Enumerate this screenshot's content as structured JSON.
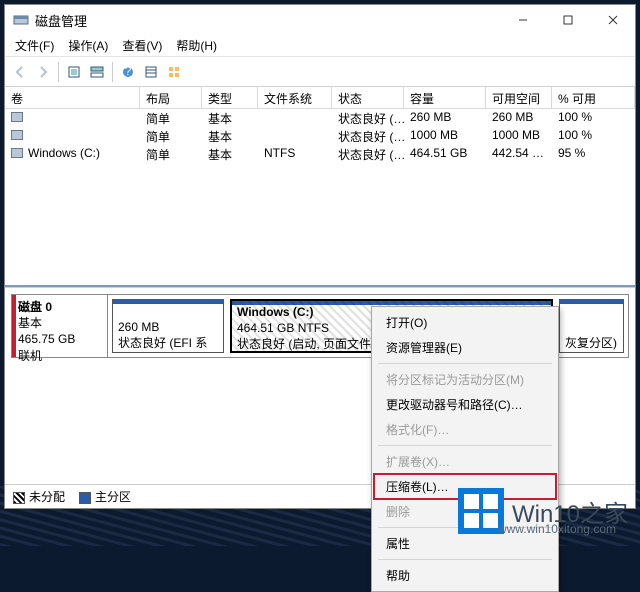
{
  "title": "磁盘管理",
  "menu": {
    "file": "文件(F)",
    "action": "操作(A)",
    "view": "查看(V)",
    "help": "帮助(H)"
  },
  "columns": {
    "volume": "卷",
    "layout": "布局",
    "type": "类型",
    "fs": "文件系统",
    "status": "状态",
    "capacity": "容量",
    "free": "可用空间",
    "pct": "% 可用"
  },
  "volumes": [
    {
      "name": "",
      "layout": "简单",
      "type": "基本",
      "fs": "",
      "status": "状态良好 (…",
      "capacity": "260 MB",
      "free": "260 MB",
      "pct": "100 %"
    },
    {
      "name": "",
      "layout": "简单",
      "type": "基本",
      "fs": "",
      "status": "状态良好 (…",
      "capacity": "1000 MB",
      "free": "1000 MB",
      "pct": "100 %"
    },
    {
      "name": "Windows (C:)",
      "layout": "简单",
      "type": "基本",
      "fs": "NTFS",
      "status": "状态良好 (…",
      "capacity": "464.51 GB",
      "free": "442.54 …",
      "pct": "95 %"
    }
  ],
  "disk": {
    "label": "磁盘 0",
    "type": "基本",
    "size": "465.75 GB",
    "state": "联机",
    "p1": {
      "size": "260 MB",
      "desc": "状态良好 (EFI 系统分区"
    },
    "p2": {
      "title": "Windows  (C:)",
      "size": "464.51 GB NTFS",
      "desc": "状态良好 (启动, 页面文件, 故"
    },
    "p3": {
      "desc": "灰复分区)"
    }
  },
  "legend": {
    "unalloc": "未分配",
    "primary": "主分区"
  },
  "ctx": {
    "open": "打开(O)",
    "explorer": "资源管理器(E)",
    "markactive": "将分区标记为活动分区(M)",
    "changepath": "更改驱动器号和路径(C)…",
    "format": "格式化(F)…",
    "extend": "扩展卷(X)…",
    "shrink": "压缩卷(L)…",
    "delete": "删除",
    "props": "属性",
    "help": "帮助"
  },
  "brand": {
    "name": "Win10之家",
    "url": "www.win10xitong.com"
  }
}
